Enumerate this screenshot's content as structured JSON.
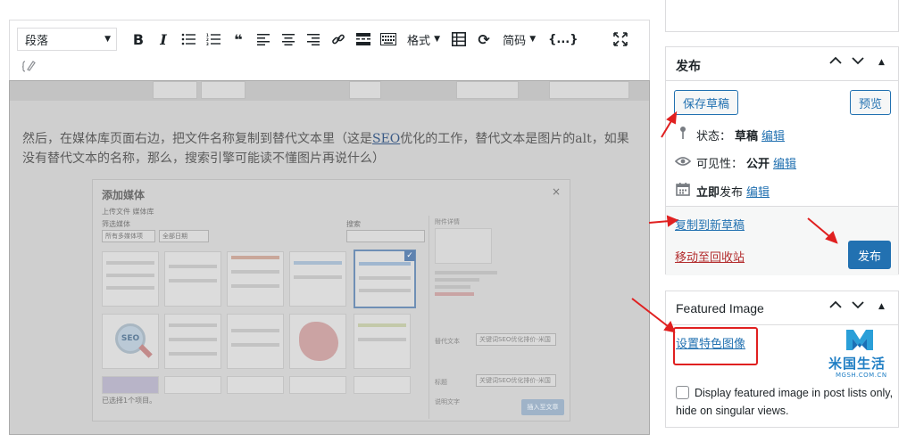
{
  "toolbar": {
    "format_value": "段落",
    "format_label": "格式",
    "code_label": "简码",
    "brace_label": "{...}"
  },
  "editor": {
    "paragraph_before": "然后，在媒体库页面右边，把文件名称复制到替代文本里（这是",
    "paragraph_link": "SEO",
    "paragraph_after": "优化的工作，替代文本是图片的alt，如果没有替代文本的名称，那么，搜索引擎可能读不懂图片再说什么）",
    "media_dialog": {
      "title": "添加媒体",
      "tabs": "上传文件   媒体库",
      "filter_label": "筛选媒体",
      "filter_type": "所有多媒体项",
      "filter_date": "全部日期",
      "search_label": "搜索",
      "details_label": "附件详情",
      "alt_label": "替代文本",
      "alt_value": "关键词SEO优化排价-米国",
      "title_label": "标题",
      "title_value": "关键词SEO优化排价-米国",
      "caption_label": "说明文字",
      "seo_badge": "SEO",
      "footer": "已选择1个项目。",
      "insert_button": "插入至文章"
    }
  },
  "publish": {
    "title": "发布",
    "save_draft": "保存草稿",
    "preview": "预览",
    "status_label": "状态：",
    "status_value": "草稿",
    "visibility_label": "可见性：",
    "visibility_value": "公开",
    "schedule_value": "立即",
    "schedule_label": "发布",
    "edit_link": "编辑",
    "copy_draft": "复制到新草稿",
    "trash": "移动至回收站",
    "publish_button": "发布"
  },
  "featured": {
    "title": "Featured Image",
    "set_image": "设置特色图像",
    "checkbox_label": "Display featured image in post lists only, hide on singular views."
  },
  "watermark": {
    "cn": "米国生活",
    "en": "MGSH.COM.CN"
  },
  "colors": {
    "accent": "#2271b1",
    "trash": "#b32d2e",
    "annotation": "#e02020"
  }
}
